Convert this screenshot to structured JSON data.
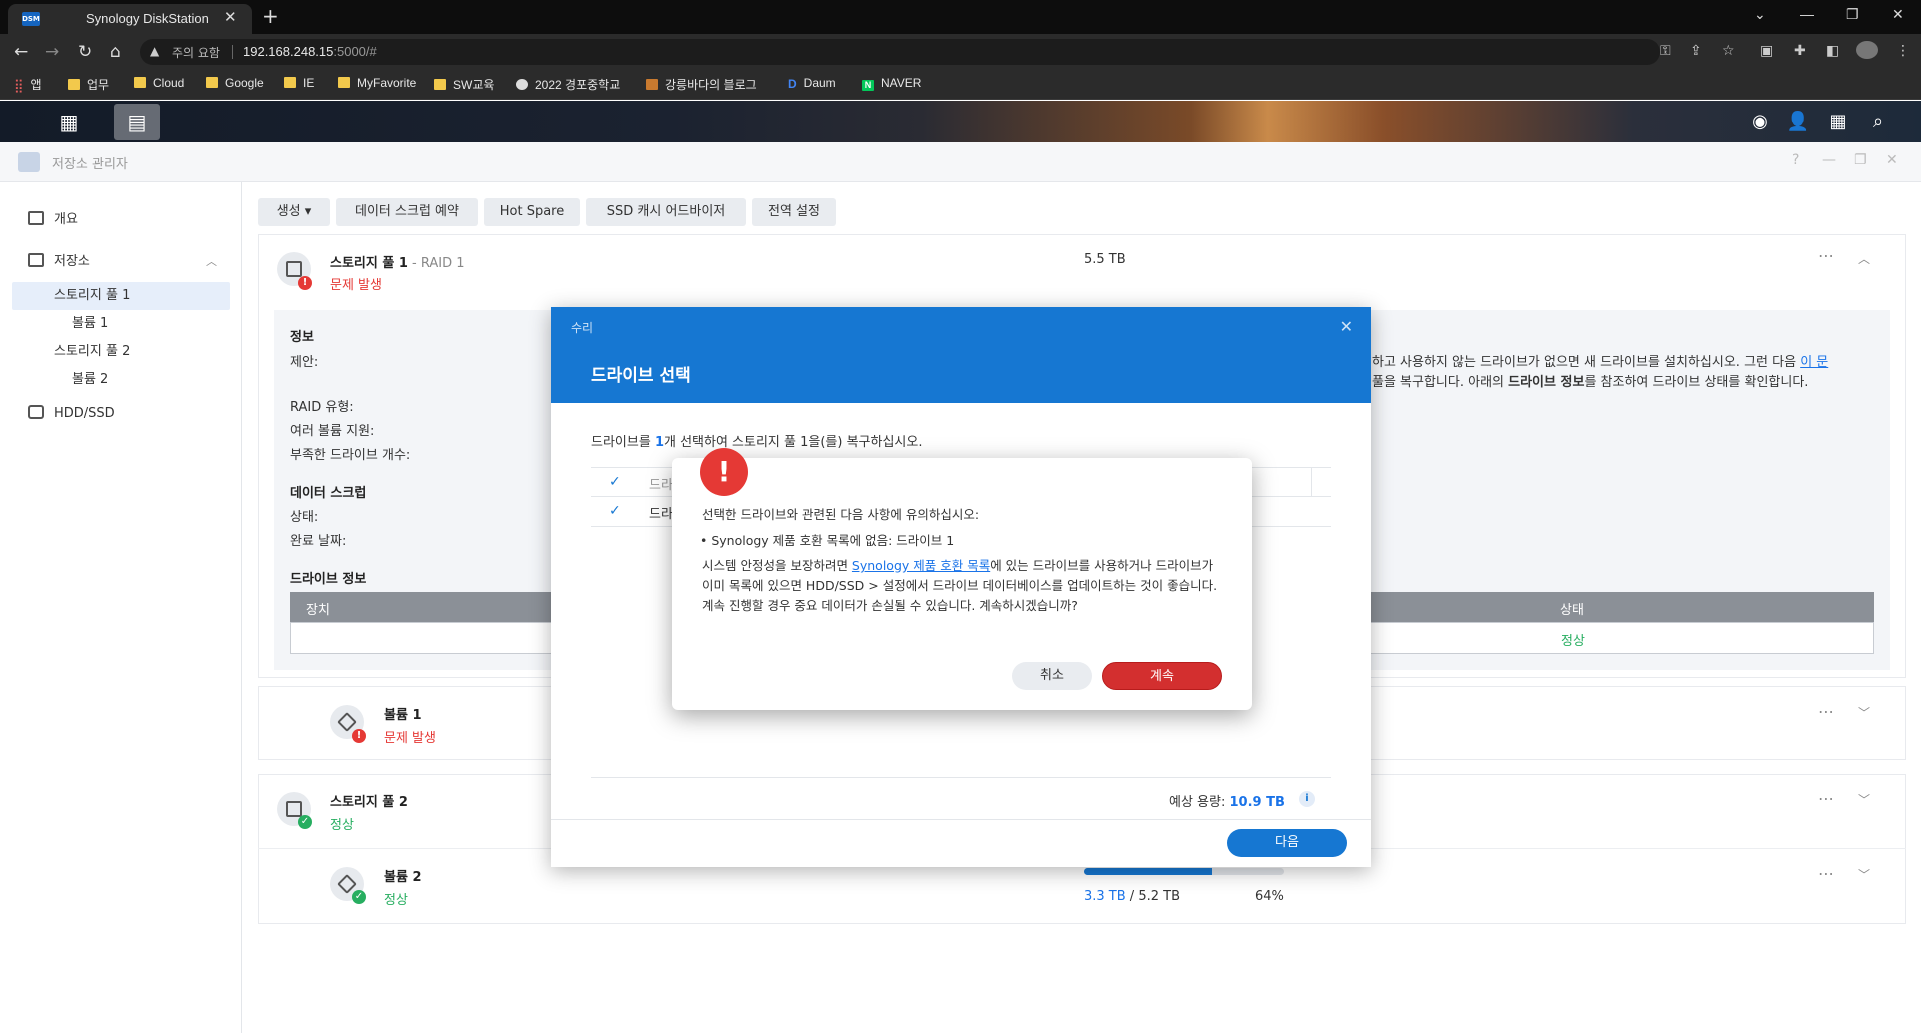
{
  "browser": {
    "tab_title": "Synology DiskStation",
    "tab_favicon": "DSM",
    "url_warning": "주의 요함",
    "url_host": "192.168.248.15",
    "url_rest": ":5000/#",
    "bookmarks": [
      "앱",
      "업무",
      "Cloud",
      "Google",
      "IE",
      "MyFavorite",
      "SW교육",
      "2022 경포중학교",
      "강릉바다의 블로그",
      "Daum",
      "NAVER"
    ]
  },
  "app": {
    "title": "저장소 관리자"
  },
  "sidebar": {
    "items": [
      {
        "label": "개요"
      },
      {
        "label": "저장소"
      },
      {
        "label": "스토리지 풀 1"
      },
      {
        "label": "볼륨 1"
      },
      {
        "label": "스토리지 풀 2"
      },
      {
        "label": "볼륨 2"
      },
      {
        "label": "HDD/SSD"
      }
    ]
  },
  "toolbar": {
    "create": "생성 ▾",
    "scrub": "데이터 스크럽 예약",
    "hotspare": "Hot Spare",
    "ssd": "SSD 캐시 어드바이저",
    "global": "전역 설정"
  },
  "pool1": {
    "name": "스토리지 풀 1",
    "raid": " - RAID 1",
    "status": "문제 발생",
    "size": "5.5 TB",
    "info_title": "정보",
    "suggest_label": "제안:",
    "suggest_text_1": "하고 사용하지 않는 드라이브가 없으면 새 드라이브를 설치하십시오. 그런 다음 ",
    "suggest_link": "이 문",
    "suggest_text_2a": "풀을 복구합니다. 아래의 ",
    "suggest_bold": "드라이브 정보",
    "suggest_text_2b": "를 참조하여 드라이브 상태를 확인합니다.",
    "raid_type": "RAID 유형:",
    "multi_vol": "여러 볼륨 지원:",
    "missing": "부족한 드라이브 개수:",
    "scrub_title": "데이터 스크럽",
    "scrub_state": "상태:",
    "scrub_date": "완료 날짜:",
    "drive_info": "드라이브 정보",
    "col_device": "장치",
    "col_status": "상태",
    "row_status": "정상"
  },
  "volume1": {
    "name": "볼륨 1",
    "status": "문제 발생"
  },
  "pool2": {
    "name": "스토리지 풀 2",
    "status": "정상"
  },
  "volume2": {
    "name": "볼륨 2",
    "status": "정상",
    "used": "3.3 TB",
    "total": " / 5.2 TB",
    "percent": "64%",
    "usage_fraction": 0.64
  },
  "repair": {
    "small_title": "수리",
    "title": "드라이브 선택",
    "instr_a": "드라이브를 ",
    "instr_num": "1",
    "instr_b": "개 선택하여 스토리지 풀 1을(를) 복구하십시오.",
    "row_label": "드라",
    "est_label": "예상 용량: ",
    "est_value": "10.9 TB",
    "next": "다음"
  },
  "alert": {
    "line1": "선택한 드라이브와 관련된 다음 사항에 유의하십시오:",
    "bullet": "• Synology 제품 호환 목록에 없음: 드라이브 1",
    "p_a": "시스템 안정성을 보장하려면 ",
    "p_link": "Synology 제품 호환 목록",
    "p_b": "에 있는 드라이브를 사용하거나 드라이브가 이미 목록에 있으면 HDD/SSD > 설정에서 드라이브 데이터베이스를 업데이트하는 것이 좋습니다. 계속 진행할 경우 중요 데이터가 손실될 수 있습니다. 계속하시겠습니까?",
    "cancel": "취소",
    "continue": "계속"
  },
  "colors": {
    "accent": "#1677d2",
    "danger": "#e53935",
    "success": "#27ae60"
  }
}
